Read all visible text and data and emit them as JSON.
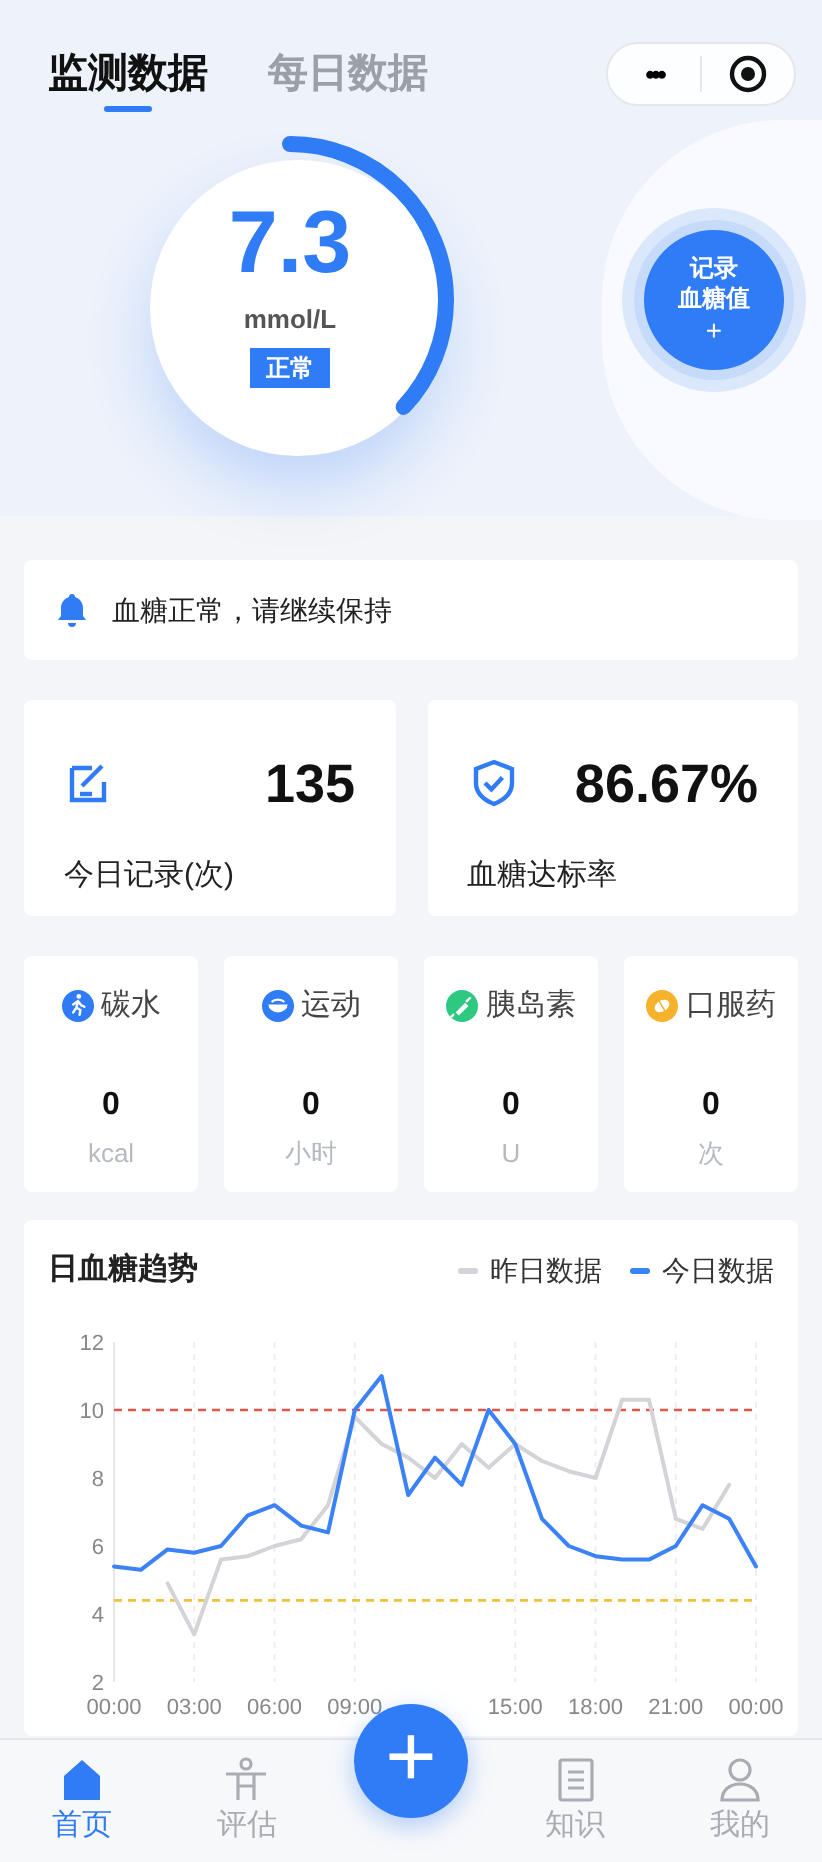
{
  "tabs": [
    {
      "label": "监测数据",
      "selected": true
    },
    {
      "label": "每日数据",
      "selected": false
    }
  ],
  "capsule": {
    "more": "•••"
  },
  "gauge": {
    "value": "7.3",
    "unit": "mmol/L",
    "status": "正常",
    "level": 0.37
  },
  "record_button": {
    "label_lines": [
      "记录",
      "血糖值"
    ],
    "plus": "+"
  },
  "alert": {
    "text": "血糖正常，请继续保持"
  },
  "stats": [
    {
      "value": "135",
      "label": "今日记录(次)"
    },
    {
      "value": "86.67%",
      "label": "血糖达标率"
    }
  ],
  "metrics": [
    {
      "name": "碳水",
      "value": "0",
      "unit": "kcal",
      "color": "#2f7cf6"
    },
    {
      "name": "运动",
      "value": "0",
      "unit": "小时",
      "color": "#2f7cf6"
    },
    {
      "name": "胰岛素",
      "value": "0",
      "unit": "U",
      "color": "#2ec980"
    },
    {
      "name": "口服药",
      "value": "0",
      "unit": "次",
      "color": "#f6b22a"
    }
  ],
  "trend": {
    "title": "日血糖趋势",
    "chart_data": {
      "type": "line",
      "x": [
        0,
        1,
        2,
        3,
        4,
        5,
        6,
        7,
        8,
        9,
        10,
        11,
        12,
        13,
        14,
        15,
        16,
        17,
        18,
        19,
        20,
        21,
        22,
        23,
        24
      ],
      "series": [
        {
          "name": "昨日数据",
          "color": "#d4d4d8",
          "values": [
            null,
            null,
            4.9,
            3.4,
            5.6,
            5.7,
            6.0,
            6.2,
            7.2,
            9.8,
            9.0,
            8.6,
            8.0,
            9.0,
            8.3,
            9.0,
            8.5,
            8.2,
            8.0,
            10.3,
            10.3,
            6.8,
            6.5,
            7.8,
            null
          ]
        },
        {
          "name": "今日数据",
          "color": "#3b82f6",
          "values": [
            5.4,
            5.3,
            5.9,
            5.8,
            6.0,
            6.9,
            7.2,
            6.6,
            6.4,
            10.0,
            11.0,
            7.5,
            8.6,
            7.8,
            10.0,
            9.0,
            6.8,
            6.0,
            5.7,
            5.6,
            5.6,
            6.0,
            7.2,
            6.8,
            5.4
          ]
        }
      ],
      "xlim": [
        0,
        24
      ],
      "ylim": [
        2,
        12
      ],
      "xticks": [
        {
          "value": 0,
          "label": "00:00"
        },
        {
          "value": 3,
          "label": "03:00"
        },
        {
          "value": 6,
          "label": "06:00"
        },
        {
          "value": 9,
          "label": "09:00"
        },
        {
          "value": 15,
          "label": "15:00"
        },
        {
          "value": 18,
          "label": "18:00"
        },
        {
          "value": 21,
          "label": "21:00"
        },
        {
          "value": 24,
          "label": "00:00"
        }
      ],
      "yticks": [
        2,
        4,
        6,
        8,
        10,
        12
      ],
      "grid": true,
      "ref_lines": [
        {
          "axis": "y",
          "value": 10,
          "color": "#e5534b"
        },
        {
          "axis": "y",
          "value": 4.4,
          "color": "#f0c23a"
        }
      ]
    }
  },
  "nav": [
    {
      "label": "首页",
      "selected": true
    },
    {
      "label": "评估",
      "selected": false
    },
    {
      "label": "知识",
      "selected": false
    },
    {
      "label": "我的",
      "selected": false
    }
  ],
  "fab": {
    "symbol": "+"
  }
}
